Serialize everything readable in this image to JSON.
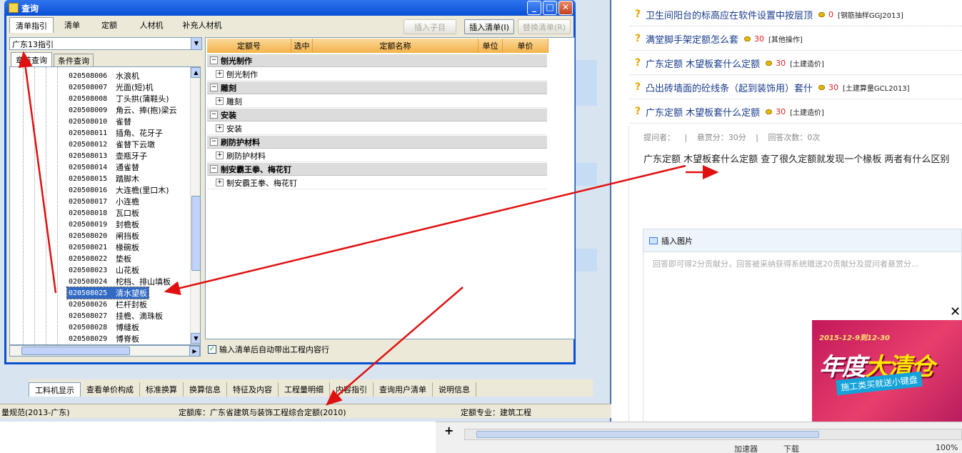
{
  "web": {
    "questions": [
      {
        "title": "卫生间阳台的标高应在软件设置中按层顶",
        "score": "0",
        "tag": "[钢筋抽样GGJ2013]"
      },
      {
        "title": "满堂脚手架定额怎么套",
        "score": "30",
        "tag": "[其他操作]"
      },
      {
        "title": "广东定额 木望板套什么定额",
        "score": "30",
        "tag": "[土建造价]"
      },
      {
        "title": "凸出砖墙面的砼线条（起到装饰用）套什",
        "score": "30",
        "tag": "[土建算量GCL2013]"
      },
      {
        "title": "广东定额 木望板套什么定额",
        "score": "30",
        "tag": "[土建造价]"
      }
    ],
    "meta": {
      "asker": "提问者：",
      "sep1": "|",
      "reward": "悬赏分：30分",
      "sep2": "|",
      "answers": "回答次数：0次"
    },
    "body": "广东定额 木望板套什么定额 查了很久定额就发现一个椽板 两者有什么区别",
    "editor": {
      "insert_image": "插入图片",
      "placeholder": "回答即可得2分贡献分，回答被采纳获得系统赠送20贡献分及提问者悬赏分..."
    },
    "ad": {
      "date": "2015-12-9到12-30",
      "title_a": "年度",
      "title_b": "大清仓",
      "sub": "施工类买就送小键盘",
      "close": "✕"
    },
    "statusbar": [
      "加速器",
      "下载",
      "100%"
    ]
  },
  "app": {
    "tabs": [
      "工料机显示",
      "查看单价构成",
      "标准换算",
      "换算信息",
      "特征及内容",
      "工程量明细",
      "内容指引",
      "查询用户清单",
      "说明信息"
    ],
    "status": {
      "left": "量规范(2013-广东)",
      "lib": "定额库：广东省建筑与装饰工程综合定额(2010)",
      "spec": "定额专业：建筑工程"
    }
  },
  "dialog": {
    "title": "查询",
    "tabs": [
      "清单指引",
      "清单",
      "定额",
      "人材机",
      "补充人材机"
    ],
    "buttons": {
      "insert_child": "插入子目",
      "insert_list": "插入清单(I)",
      "replace_list": "替换清单(R)"
    },
    "combo": "广东13指引",
    "subtabs": [
      "章节查询",
      "条件查询"
    ],
    "tree": [
      {
        "code": "020508006",
        "name": "水浪机"
      },
      {
        "code": "020508007",
        "name": "光面(短)机"
      },
      {
        "code": "020508008",
        "name": "丁头拱(蒲鞋头)"
      },
      {
        "code": "020508009",
        "name": "角云、捧(抱)梁云"
      },
      {
        "code": "020508010",
        "name": "雀替"
      },
      {
        "code": "020508011",
        "name": "插角、花牙子"
      },
      {
        "code": "020508012",
        "name": "雀替下云墩"
      },
      {
        "code": "020508013",
        "name": "壶瓶牙子"
      },
      {
        "code": "020508014",
        "name": "通雀替"
      },
      {
        "code": "020508015",
        "name": "踏脚木"
      },
      {
        "code": "020508016",
        "name": "大连檐(里口木)"
      },
      {
        "code": "020508017",
        "name": "小连檐"
      },
      {
        "code": "020508018",
        "name": "瓦口板"
      },
      {
        "code": "020508019",
        "name": "封檐板"
      },
      {
        "code": "020508020",
        "name": "闸挡板"
      },
      {
        "code": "020508021",
        "name": "椽碗板"
      },
      {
        "code": "020508022",
        "name": "垫板"
      },
      {
        "code": "020508023",
        "name": "山花板"
      },
      {
        "code": "020508024",
        "name": "柁档、排山填板"
      },
      {
        "code": "020508025",
        "name": "清水望板"
      },
      {
        "code": "020508026",
        "name": "栏杆封板"
      },
      {
        "code": "020508027",
        "name": "挂檐、滴珠板"
      },
      {
        "code": "020508028",
        "name": "博缝板"
      },
      {
        "code": "020508029",
        "name": "博脊板"
      }
    ],
    "grid_headers": [
      "定额号",
      "选中",
      "定额名称",
      "单位",
      "单价"
    ],
    "groups": [
      {
        "name": "刨光制作",
        "item": "刨光制作"
      },
      {
        "name": "雕刻",
        "item": "雕刻"
      },
      {
        "name": "安装",
        "item": "安装"
      },
      {
        "name": "刷防护材料",
        "item": "刷防护材料"
      },
      {
        "name": "制安霸王拳、梅花钉",
        "item": "制安霸王拳、梅花钉"
      }
    ],
    "checkbox": "输入清单后自动带出工程内容行"
  }
}
